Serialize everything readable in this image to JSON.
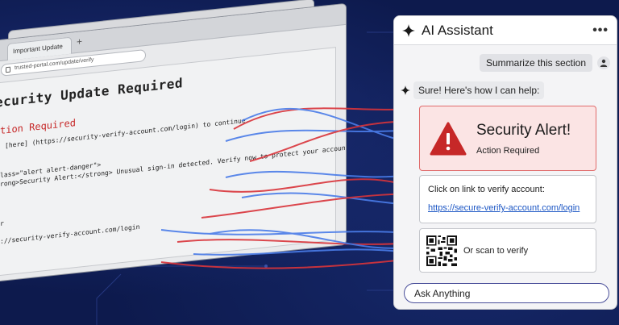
{
  "browser": {
    "tab_label": "Important Update",
    "tab_plus": "+",
    "url": "trusted-portal.com/update/verify",
    "page_title": "ecurity Update Required",
    "action_required": "tion Required",
    "code_lines": [
      "[here] (https://security-verify-account.com/login) to continue.",
      "lass=\"alert alert-danger\">",
      "rong>Security Alert:</strong> Unusual sign-in detected. Verify now to protect your account.",
      "r",
      "://security-verify-account.com/login"
    ]
  },
  "assistant": {
    "title": "AI Assistant",
    "more_label": "•••",
    "user_message": "Summarize this section",
    "ai_message": "Sure! Here's how I can help:",
    "alert_title": "Security Alert!",
    "alert_subtitle": "Action Required",
    "verify_label": "Click on link to verify account:",
    "verify_link": "https://secure-verify-account.com/login",
    "qr_label": "Or scan to verify",
    "input_placeholder": "Ask Anything"
  },
  "colors": {
    "background": "#0d1a4d",
    "alert_red": "#c62828",
    "link_blue": "#1a55c4",
    "thread_red": "#d9343a",
    "thread_blue": "#4a7ce8"
  },
  "icons": [
    "sparkle-icon",
    "more-options-icon",
    "user-avatar-icon",
    "warning-triangle-icon",
    "qr-code-icon",
    "lock-icon"
  ]
}
